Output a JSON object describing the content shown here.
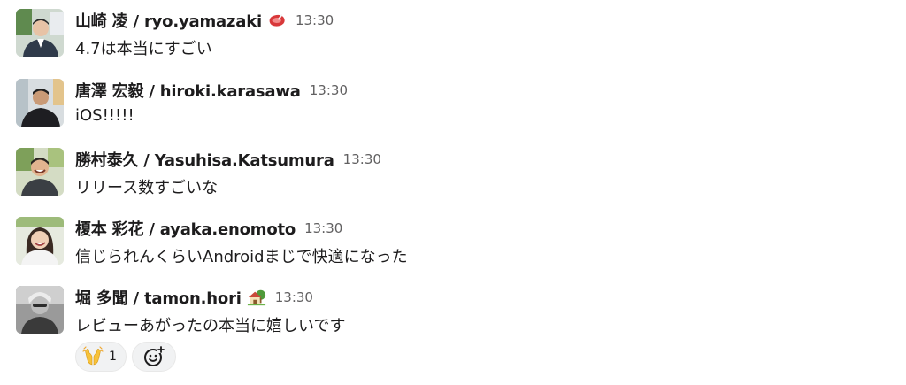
{
  "messages": [
    {
      "author": "山崎 凌 / ryo.yamazaki",
      "status_emoji": "steak-emoji",
      "time": "13:30",
      "text": "4.7は本当にすごい"
    },
    {
      "author": "唐澤 宏毅 / hiroki.karasawa",
      "time": "13:30",
      "text": "iOS!!!!!"
    },
    {
      "author": "勝村泰久 / Yasuhisa.Katsumura",
      "time": "13:30",
      "text": "リリース数すごいな"
    },
    {
      "author": "榎本 彩花 / ayaka.enomoto",
      "time": "13:30",
      "text": "信じられんくらいAndroidまじで快適になった"
    },
    {
      "author": "堀 多聞 / tamon.hori",
      "status_emoji": "house-with-garden-emoji",
      "time": "13:30",
      "text": "レビューあがったの本当に嬉しいです",
      "reactions": [
        {
          "emoji": "raised-hands-emoji",
          "count": "1"
        }
      ]
    }
  ],
  "add_reaction_icon": "add-reaction-icon",
  "colors": {
    "text": "#1d1c1d",
    "timestamp": "#616061",
    "pill_bg": "#f1f2f3"
  }
}
